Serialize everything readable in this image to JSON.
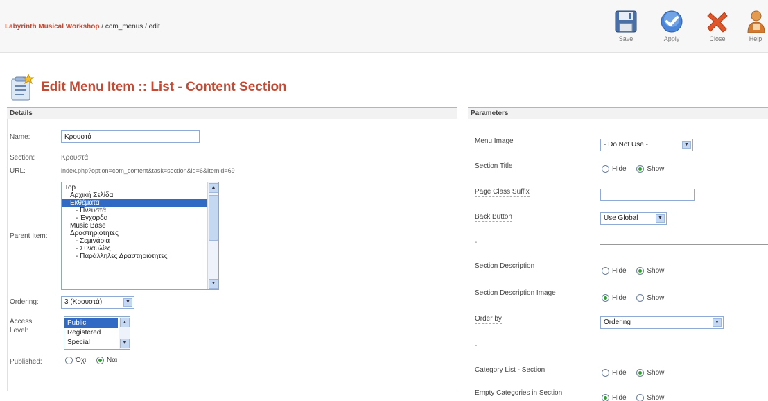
{
  "header": {
    "site_name": "Labyrinth Musical Workshop",
    "path": " / com_menus / edit"
  },
  "toolbar": {
    "save_label": "Save",
    "apply_label": "Apply",
    "close_label": "Close",
    "help_label": "Help"
  },
  "page": {
    "title": "Edit Menu Item :: List - Content Section"
  },
  "details": {
    "heading": "Details",
    "name_label": "Name:",
    "name_value": "Κρουστά",
    "section_label": "Section:",
    "section_value": "Κρουστά",
    "url_label": "URL:",
    "url_value": "index.php?option=com_content&task=section&id=6&Itemid=69",
    "parent_label": "Parent Item:",
    "parent_items": [
      {
        "label": "Top",
        "indent": 0,
        "selected": false
      },
      {
        "label": "Αρχική Σελίδα",
        "indent": 1,
        "selected": false
      },
      {
        "label": "Εκθέματα",
        "indent": 1,
        "selected": true
      },
      {
        "label": "- Πνευστά",
        "indent": 2,
        "selected": false
      },
      {
        "label": "- Έγχορδα",
        "indent": 2,
        "selected": false
      },
      {
        "label": "Music Base",
        "indent": 1,
        "selected": false
      },
      {
        "label": "Δραστηριότητες",
        "indent": 1,
        "selected": false
      },
      {
        "label": "- Σεμινάρια",
        "indent": 2,
        "selected": false
      },
      {
        "label": "- Συναυλίες",
        "indent": 2,
        "selected": false
      },
      {
        "label": "- Παράλληλες Δραστηριότητες",
        "indent": 2,
        "selected": false
      }
    ],
    "ordering_label": "Ordering:",
    "ordering_value": "3 (Κρουστά)",
    "access_label_1": "Access",
    "access_label_2": "Level:",
    "access_options": [
      {
        "label": "Public",
        "selected": true
      },
      {
        "label": "Registered",
        "selected": false
      },
      {
        "label": "Special",
        "selected": false
      }
    ],
    "published_label": "Published:",
    "published_no": "Όχι",
    "published_yes": "Ναι",
    "published_value": "yes"
  },
  "parameters": {
    "heading": "Parameters",
    "menu_image_label": "Menu Image",
    "menu_image_value": "- Do Not Use -",
    "section_title_label": "Section Title",
    "page_class_label": "Page Class Suffix",
    "page_class_value": "",
    "back_button_label": "Back Button",
    "back_button_value": "Use Global",
    "dash": "-",
    "section_desc_label": "Section Description",
    "section_desc_image_label": "Section Description Image",
    "order_by_label": "Order by",
    "order_by_value": "Ordering",
    "category_list_label": "Category List - Section",
    "empty_categories_label": "Empty Categories in Section",
    "hide": "Hide",
    "show": "Show"
  }
}
